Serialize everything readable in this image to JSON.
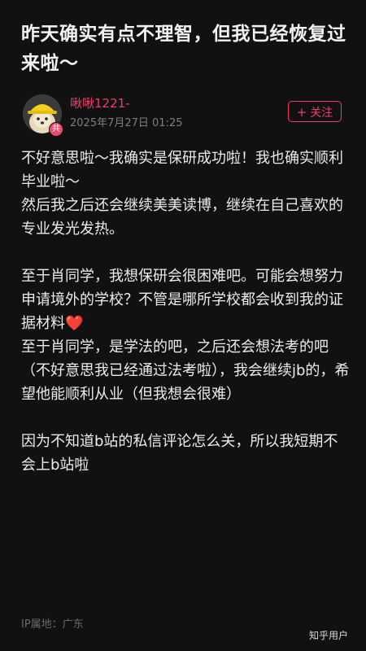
{
  "post": {
    "title": "昨天确实有点不理智，但我已经恢复过来啦～"
  },
  "author": {
    "name": "啾啾1221-",
    "time": "2025年7月27日 01:25",
    "badge": "共",
    "follow_label": "关注",
    "follow_icon": "plus-icon"
  },
  "content": {
    "p1": "不好意思啦～我确实是保研成功啦！我也确实顺利毕业啦～",
    "p2": "然后我之后还会继续美美读博，继续在自己喜欢的专业发光发热。",
    "p3_text": "至于肖同学，我想保研会很困难吧。可能会想努力申请境外的学校？不管是哪所学校都会收到我的证据材料",
    "p3_emoji": "❤️",
    "p4": "至于肖同学，是学法的吧，之后还会想法考的吧（不好意思我已经通过法考啦），我会继续jb的，希望他能顺利从业（但我想会很难）",
    "p5": "因为不知道b站的私信评论怎么关，所以我短期不会上b站啦"
  },
  "footer": {
    "ip": "IP属地：广东",
    "watermark": "知乎用户"
  },
  "colors": {
    "accent": "#ee3d6d",
    "background": "#111112",
    "heart": "#e0283e"
  }
}
